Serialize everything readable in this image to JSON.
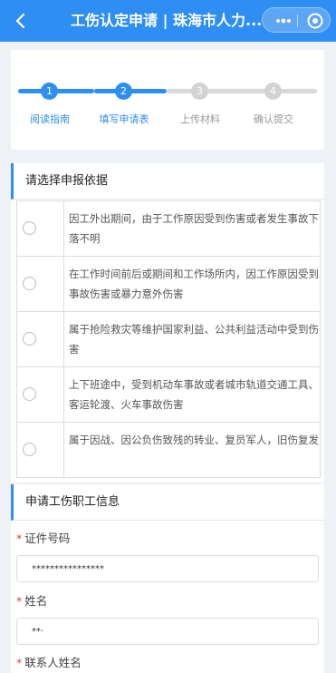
{
  "navbar": {
    "title": "工伤认定申请 | 珠海市人力...",
    "back_icon": "chevron-left-icon",
    "more_icon": "more-dots-icon",
    "close_icon": "target-close-icon",
    "color": "#2f8ef2"
  },
  "stepper": {
    "steps": [
      {
        "number": "1",
        "label": "阅读指南",
        "state": "done"
      },
      {
        "number": "2",
        "label": "填写申请表",
        "state": "active"
      },
      {
        "number": "3",
        "label": "上传材料",
        "state": "pending"
      },
      {
        "number": "4",
        "label": "确认提交",
        "state": "pending"
      }
    ],
    "active_color": "#2f8ef2",
    "pending_color": "#d9d9d9"
  },
  "basis_section": {
    "title": "请选择申报依据",
    "options": [
      {
        "text": "因工外出期间，由于工作原因受到伤害或者发生事故下落不明"
      },
      {
        "text": "在工作时间前后或期间和工作场所内，因工作原因受到事故伤害或暴力意外伤害"
      },
      {
        "text": "属于抢险救灾等维护国家利益、公共利益活动中受到伤害"
      },
      {
        "text": "上下班途中，受到机动车事故或者城市轨道交通工具、客运轮渡、火车事故伤害"
      },
      {
        "text": "属于因战、因公负伤致残的转业、复员军人，旧伤复发"
      }
    ]
  },
  "worker_section": {
    "title": "申请工伤职工信息",
    "required_mark": "*",
    "fields": {
      "id_number": {
        "label": "证件号码",
        "value": "****************"
      },
      "name": {
        "label": "姓名",
        "value": "**·"
      },
      "contact_name": {
        "label": "联系人姓名"
      }
    }
  }
}
